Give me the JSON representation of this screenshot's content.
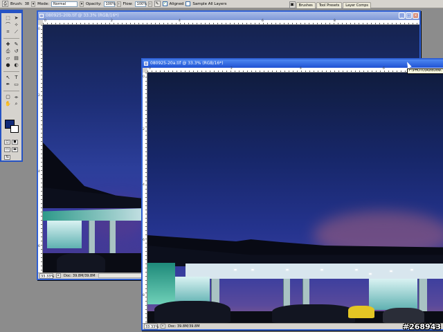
{
  "options_bar": {
    "brush_label": "Brush:",
    "brush_size": "38",
    "mode_label": "Mode:",
    "mode_value": "Normal",
    "opacity_label": "Opacity:",
    "opacity_value": "100%",
    "flow_label": "Flow:",
    "flow_value": "100%",
    "aligned_label": "Aligned",
    "aligned_checked": true,
    "sample_all_label": "Sample All Layers",
    "sample_all_checked": false
  },
  "palette_well": {
    "tabs": [
      "Brushes",
      "Tool Presets",
      "Layer Comps"
    ]
  },
  "toolbox": {
    "tools": [
      "move-icon",
      "marquee-icon",
      "lasso-icon",
      "magic-wand-icon",
      "crop-icon",
      "slice-icon",
      "healing-icon",
      "brush-icon",
      "stamp-icon",
      "history-brush-icon",
      "eraser-icon",
      "gradient-icon",
      "blur-icon",
      "dodge-icon",
      "pen-icon",
      "type-icon",
      "path-select-icon",
      "shape-icon",
      "notes-icon",
      "eyedropper-icon",
      "hand-icon",
      "zoom-icon"
    ],
    "foreground_color": "#102a78",
    "background_color": "#ffffff"
  },
  "window_back": {
    "title": "080925-20b.tif @ 33.3% (RGB/16*)",
    "zoom": "33.33%",
    "doc_info": "Doc: 39.8M/39.8M",
    "ruler_top": [
      "0",
      "2",
      "4",
      "6",
      "8",
      "10",
      "12"
    ],
    "ruler_left": [
      "0",
      "2",
      "4",
      "6",
      "8"
    ]
  },
  "window_front": {
    "title": "080925-20a.tif @ 33.3% (RGB/16*)",
    "zoom": "33.33%",
    "doc_info": "Doc: 39.8M/39.8M",
    "ruler_top": [
      "0",
      "2",
      "4",
      "6",
      "8",
      "10"
    ],
    "ruler_left": [
      "0",
      "2",
      "4",
      "6",
      "8"
    ]
  },
  "tooltip": "F:\\PHOTO\\AutoDow...",
  "watermark": "#268943"
}
